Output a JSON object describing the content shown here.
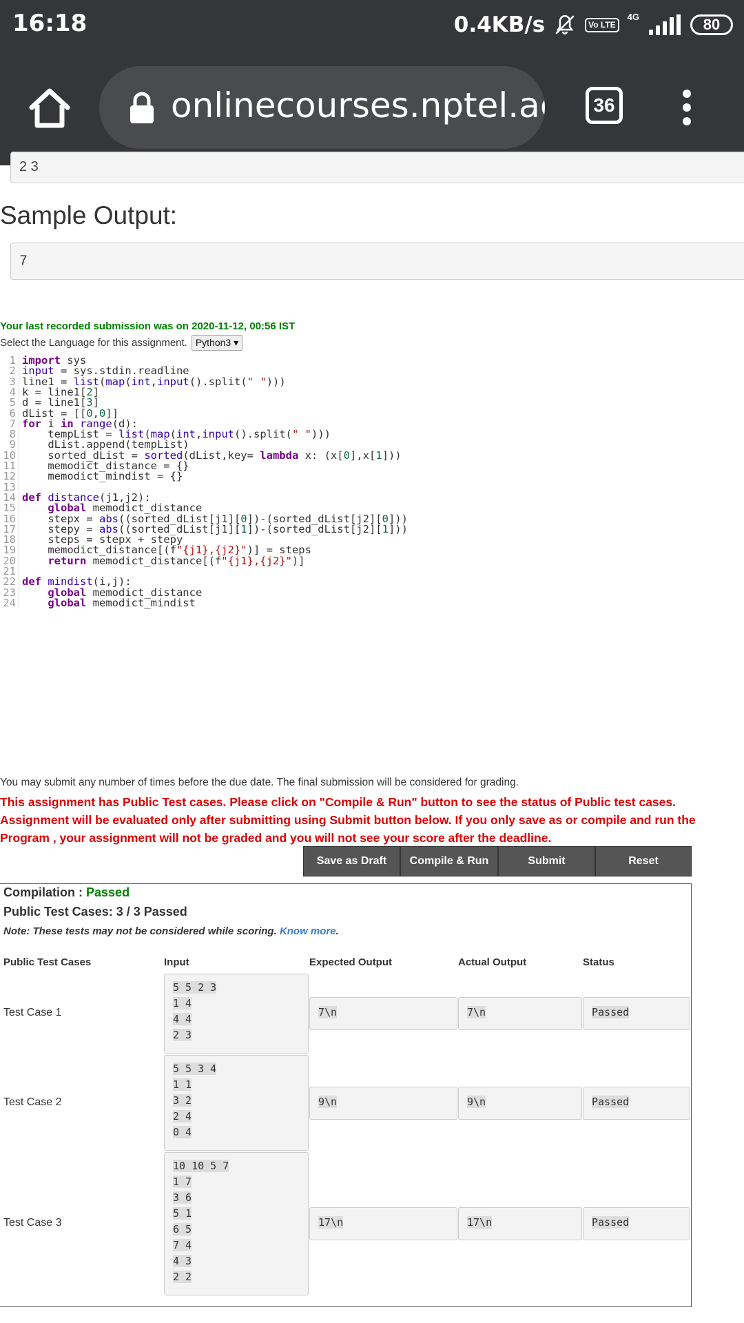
{
  "status_bar": {
    "time": "16:18",
    "speed": "0.4KB/s",
    "volte": "Vo LTE",
    "network": "4G",
    "battery": "80"
  },
  "browser": {
    "url": "onlinecourses.nptel.ac.in",
    "tab_count": "36"
  },
  "page": {
    "prev_box_text": "2 3",
    "sample_output_heading": "Sample Output:",
    "sample_output_value": "7",
    "last_submission": "Your last recorded submission was on 2020-11-12, 00:56 IST",
    "language_prompt": "Select the Language for this assignment.",
    "language_selected": "Python3 ▾",
    "code_lines": [
      "import sys",
      "input = sys.stdin.readline",
      "line1 = list(map(int,input().split(\" \")))",
      "k = line1[2]",
      "d = line1[3]",
      "dList = [[0,0]]",
      "for i in range(d):",
      "    tempList = list(map(int,input().split(\" \")))",
      "    dList.append(tempList)",
      "    sorted_dList = sorted(dList,key= lambda x: (x[0],x[1]))",
      "    memodict_distance = {}",
      "    memodict_mindist = {}",
      "",
      "def distance(j1,j2):",
      "    global memodict_distance",
      "    stepx = abs((sorted_dList[j1][0])-(sorted_dList[j2][0]))",
      "    stepy = abs((sorted_dList[j1][1])-(sorted_dList[j2][1]))",
      "    steps = stepx + stepy",
      "    memodict_distance[(f\"{j1},{j2}\")] = steps",
      "    return memodict_distance[(f\"{j1},{j2}\")]",
      "",
      "def mindist(i,j):",
      "    global memodict_distance",
      "    global memodict_mindist"
    ],
    "submit_note": "You may submit any number of times before the due date. The final submission will be considered for grading.",
    "public_warning": "This assignment has Public Test cases. Please click on \"Compile & Run\" button to see the status of Public test cases. Assignment will be evaluated only after submitting using Submit button below. If you only save as or compile and run the Program , your assignment will not be graded and you will not see your score after the deadline.",
    "buttons": {
      "save_draft": "Save as Draft",
      "compile_run": "Compile & Run",
      "submit": "Submit",
      "reset": "Reset"
    }
  },
  "results": {
    "compilation_label": "Compilation :",
    "compilation_status": "Passed",
    "public_test_summary": "Public Test Cases: 3 / 3 Passed",
    "note_text": "Note: These tests may not be considered while scoring.",
    "note_link": "Know more",
    "columns": [
      "Public Test Cases",
      "Input",
      "Expected Output",
      "Actual Output",
      "Status"
    ],
    "test_cases": [
      {
        "name": "Test Case 1",
        "input": [
          "5 5 2 3",
          "1 4",
          "4 4",
          "2 3"
        ],
        "expected": "7\\n",
        "actual": "7\\n",
        "status": "Passed"
      },
      {
        "name": "Test Case 2",
        "input": [
          "5 5 3 4",
          "1 1",
          "3 2",
          "2 4",
          "0 4"
        ],
        "expected": "9\\n",
        "actual": "9\\n",
        "status": "Passed"
      },
      {
        "name": "Test Case 3",
        "input": [
          "10 10 5 7",
          "1 7",
          "3 6",
          "5 1",
          "6 5",
          "7 4",
          "4 3",
          "2 2"
        ],
        "expected": "17\\n",
        "actual": "17\\n",
        "status": "Passed"
      }
    ]
  }
}
